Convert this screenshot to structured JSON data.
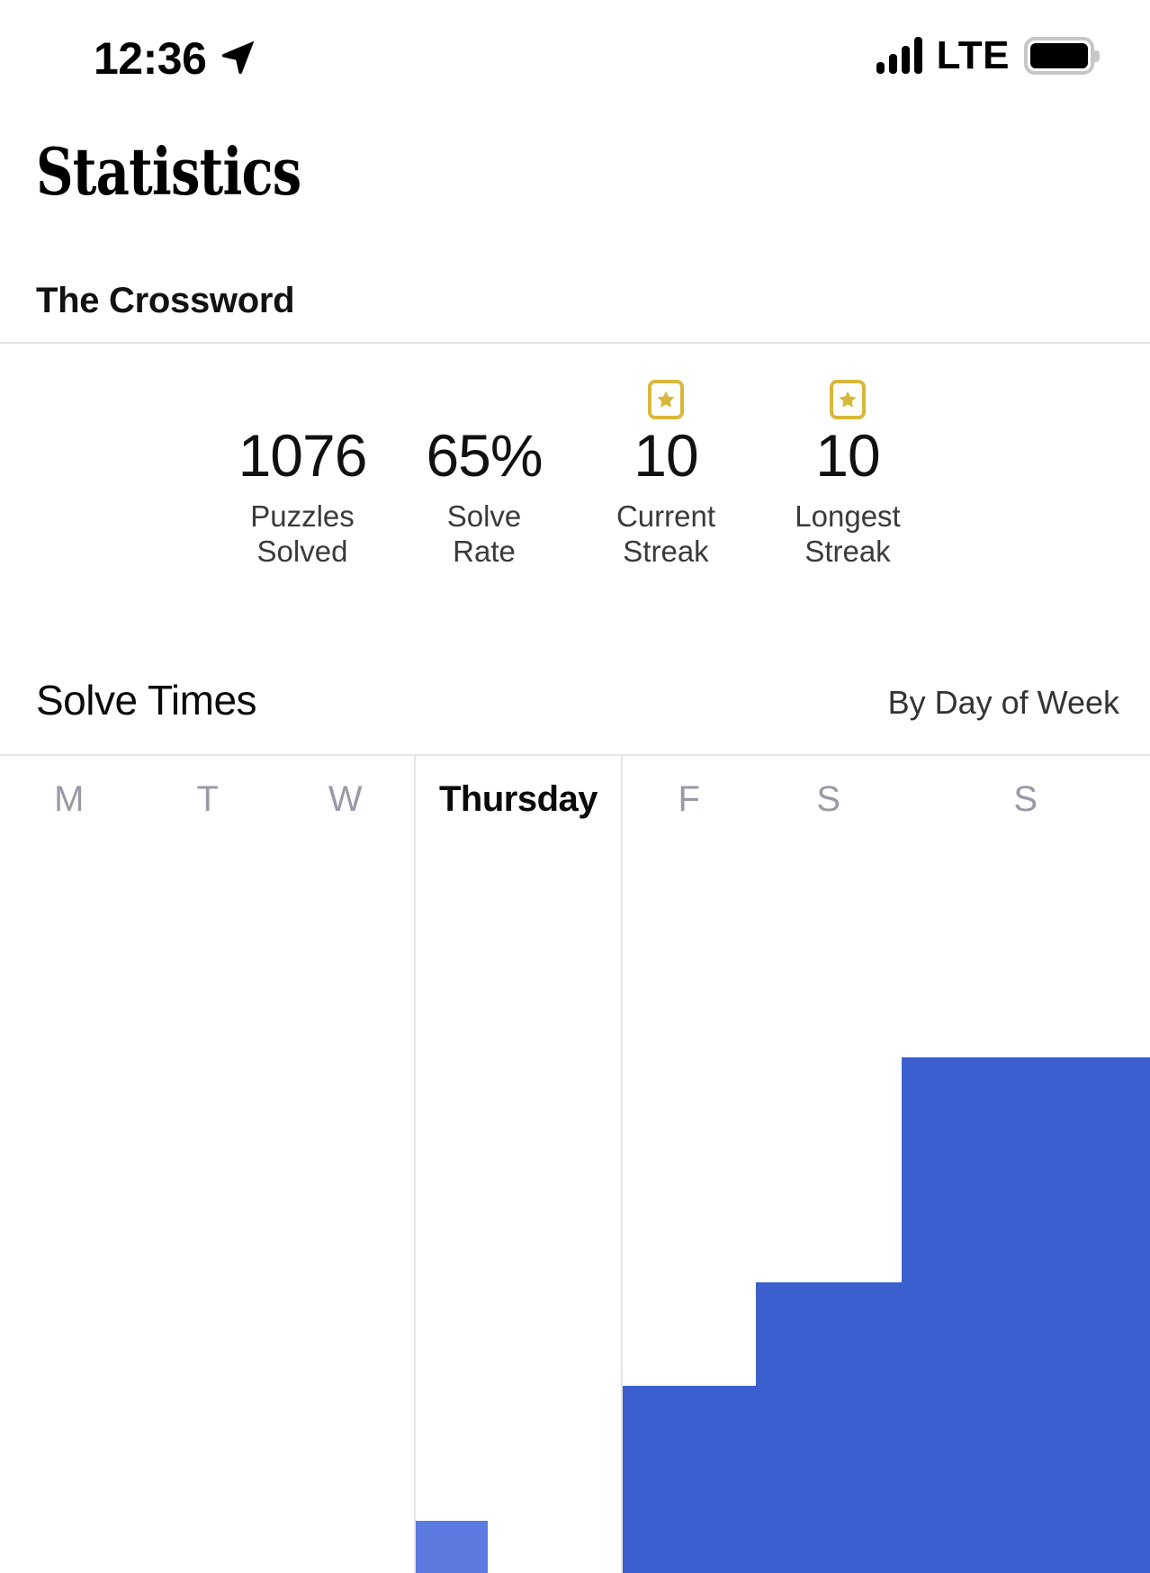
{
  "status_bar": {
    "time": "12:36",
    "location_icon": "location-arrow-icon",
    "signal_icon": "cellular-signal-icon",
    "carrier_tech": "LTE",
    "battery_icon": "battery-full-icon"
  },
  "header": {
    "title": "Statistics",
    "subtitle": "The Crossword"
  },
  "stats": [
    {
      "value": "1076",
      "label": "Puzzles\nSolved",
      "badge": null
    },
    {
      "value": "65%",
      "label": "Solve\nRate",
      "badge": null
    },
    {
      "value": "10",
      "label": "Current\nStreak",
      "badge": "gold-star-badge-icon"
    },
    {
      "value": "10",
      "label": "Longest\nStreak",
      "badge": "gold-star-badge-icon"
    }
  ],
  "section": {
    "title": "Solve Times",
    "mode": "By Day of Week"
  },
  "chart_data": {
    "type": "bar",
    "title": "Solve Times",
    "subtitle": "By Day of Week",
    "xlabel": "",
    "ylabel": "",
    "grid": false,
    "legend": null,
    "categories": [
      "M",
      "T",
      "W",
      "Thursday",
      "F",
      "S",
      "S"
    ],
    "full_categories": [
      "Monday",
      "Tuesday",
      "Wednesday",
      "Thursday",
      "Friday",
      "Saturday",
      "Sunday"
    ],
    "selected_category": "Thursday",
    "values": [
      0,
      0,
      0,
      58,
      208,
      323,
      573
    ],
    "values_unit": "px-height-from-bottom-of-visible-crop",
    "ylim": [
      0,
      908
    ],
    "colors": {
      "bar": "#3B5FCC",
      "bar_selected": "#5B7BE0",
      "label": "#9a9aa6",
      "label_selected": "#0a0a0a"
    },
    "note": "Chart is cut off by the bottom of the screen; only the tops of the Friday, Saturday and Sunday bars and a sliver of the Thursday bar are visible."
  },
  "colors": {
    "accent_blue": "#3B5FCC",
    "accent_blue_light": "#5B7BE0",
    "badge_gold": "#D9B73B",
    "divider": "#e6e6e6",
    "muted_text": "#9a9aa6"
  }
}
